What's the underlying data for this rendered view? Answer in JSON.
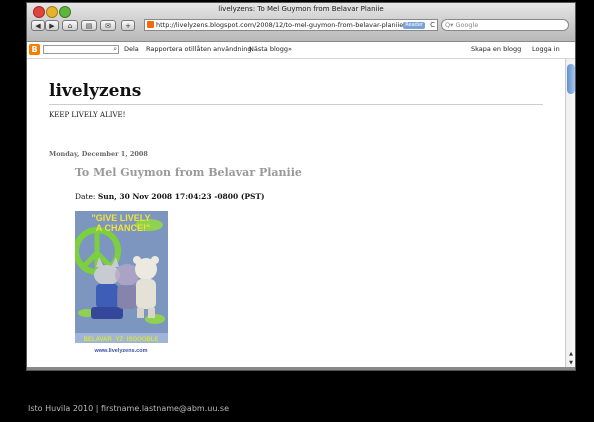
{
  "window": {
    "title": "livelyzens: To Mel Guymon from Belavar Planiie"
  },
  "toolbar": {
    "back": "◀",
    "forward": "▶",
    "home": "⌂",
    "print": "▤",
    "history": "✉",
    "add": "+",
    "url": "http://livelyzens.blogspot.com/2008/12/to-mel-guymon-from-belavar-planiie.h",
    "reader_label": "Reader",
    "reload": "C",
    "search_placeholder": "Q▾ Google"
  },
  "blogger_bar": {
    "logo": "B",
    "links": [
      "Dela",
      "Rapportera otillåten användning",
      "Nästa blogg»"
    ],
    "right_links": [
      "Skapa en blogg",
      "Logga in"
    ]
  },
  "blog": {
    "title": "livelyzens",
    "description": "KEEP LIVELY ALIVE!",
    "post_date": "Monday, December 1, 2008",
    "post_title": "To Mel Guymon from Belavar Planiie",
    "date_label": "Date:",
    "date_value": "Sun, 30 Nov 2008 17:04:23 -0800 (PST)",
    "poster": {
      "headline_1": "\"GIVE LIVELY",
      "headline_2": "A CHANCE!\"",
      "tagline": "BELAVAR  ·YZ·  ISOOOBLE",
      "url": "www.livelyzens.com"
    }
  },
  "footer": {
    "text": "Isto Huvila 2010 | firstname.lastname@abm.uu.se"
  },
  "colors": {
    "blogger_orange": "#f57d00",
    "scroll_blue": "#5f8fd0",
    "poster_bg": "#7d96bf"
  }
}
